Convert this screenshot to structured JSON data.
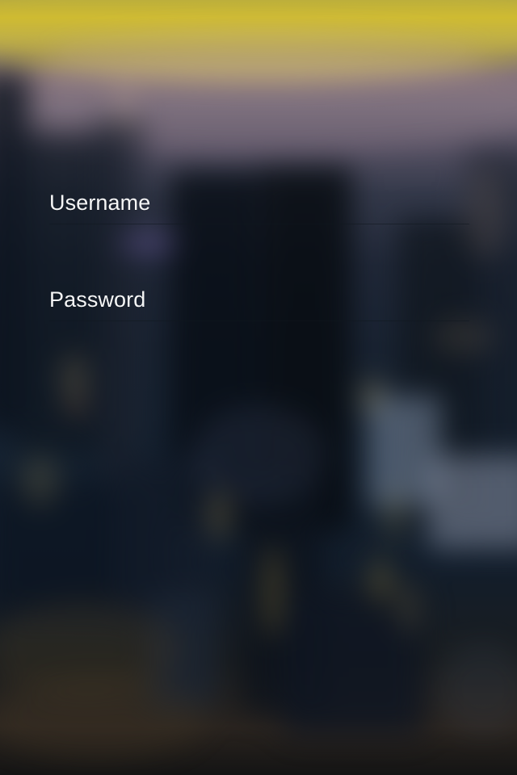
{
  "login": {
    "username": {
      "label": "Username",
      "value": "",
      "placeholder": ""
    },
    "password": {
      "label": "Password",
      "value": "",
      "placeholder": ""
    }
  }
}
